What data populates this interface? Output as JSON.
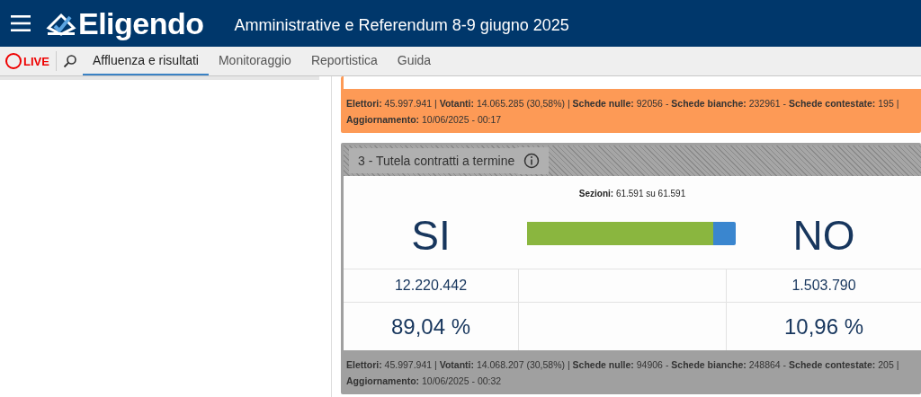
{
  "header": {
    "brand": "Eligendo",
    "title": "Amministrative e Referendum 8-9 giugno 2025"
  },
  "nav": {
    "live": "LIVE",
    "tabs": [
      {
        "label": "Affluenza e risultati",
        "selected": true
      },
      {
        "label": "Monitoraggio",
        "selected": false
      },
      {
        "label": "Reportistica",
        "selected": false
      },
      {
        "label": "Guida",
        "selected": false
      }
    ]
  },
  "cards": [
    {
      "color": "#fd9a56",
      "footer": [
        "**Elettori:** 45.997.941 | **Votanti:** 14.065.285 (30,58%) | **Schede nulle:** 92056 - **Schede bianche:** 232961 - **Schede contestate:** 195 |",
        "**Aggiornamento:** 10/06/2025 - 00:17"
      ]
    },
    {
      "color": "#a0a0a0",
      "title": "3 - Tutela contratti a termine",
      "sections": "**Sezioni:** 61.591 su 61.591",
      "yes": {
        "label": "SI",
        "votes": "12.220.442",
        "percent": "89,04 %",
        "level": 0.8904
      },
      "no": {
        "label": "NO",
        "votes": "1.503.790",
        "percent": "10,96 %"
      },
      "footer": [
        "**Elettori:** 45.997.941 | **Votanti:** 14.068.207 (30,58%) | **Schede nulle:** 94906 - **Schede bianche:** 248864 - **Schede contestate:** 205 |",
        "**Aggiornamento:** 10/06/2025 - 00:32"
      ]
    }
  ]
}
